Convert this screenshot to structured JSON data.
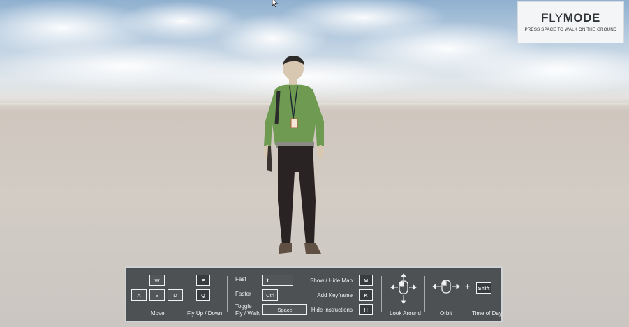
{
  "scene": {
    "name": "walkthrough-viewport"
  },
  "mode_badge": {
    "title_thin": "FLY",
    "title_bold": "MODE",
    "subtitle": "PRESS SPACE TO WALK ON THE GROUND"
  },
  "controls": {
    "move": {
      "keys": [
        "W",
        "A",
        "S",
        "D"
      ],
      "label": "Move"
    },
    "fly": {
      "keys": [
        "E",
        "Q"
      ],
      "label": "Fly Up / Down"
    },
    "fast": {
      "label": "Fast",
      "key": "⬆"
    },
    "faster": {
      "label": "Faster",
      "key": "Ctrl"
    },
    "toggle": {
      "label_line1": "Toggle",
      "label_line2": "Fly / Walk",
      "key": "Space"
    },
    "show_map": {
      "label": "Show / Hide Map",
      "key": "M"
    },
    "add_keyframe": {
      "label": "Add Keyframe",
      "key": "K"
    },
    "hide_instructions": {
      "label": "Hide instructions",
      "key": "H"
    },
    "look_around": {
      "label": "Look Around",
      "icon": "mouse-drag-icon"
    },
    "orbit": {
      "label": "Orbit",
      "icon": "mouse-drag-icon"
    },
    "time_of_day": {
      "label": "Time of Day",
      "plus": "+",
      "key": "Shift"
    }
  },
  "colors": {
    "panel_bg": "#42464a",
    "panel_border": "#cfd3d6",
    "shirt": "#6f9a52",
    "pants": "#2a2324",
    "sky": "#b9cde0",
    "ground": "#cfc6be"
  }
}
